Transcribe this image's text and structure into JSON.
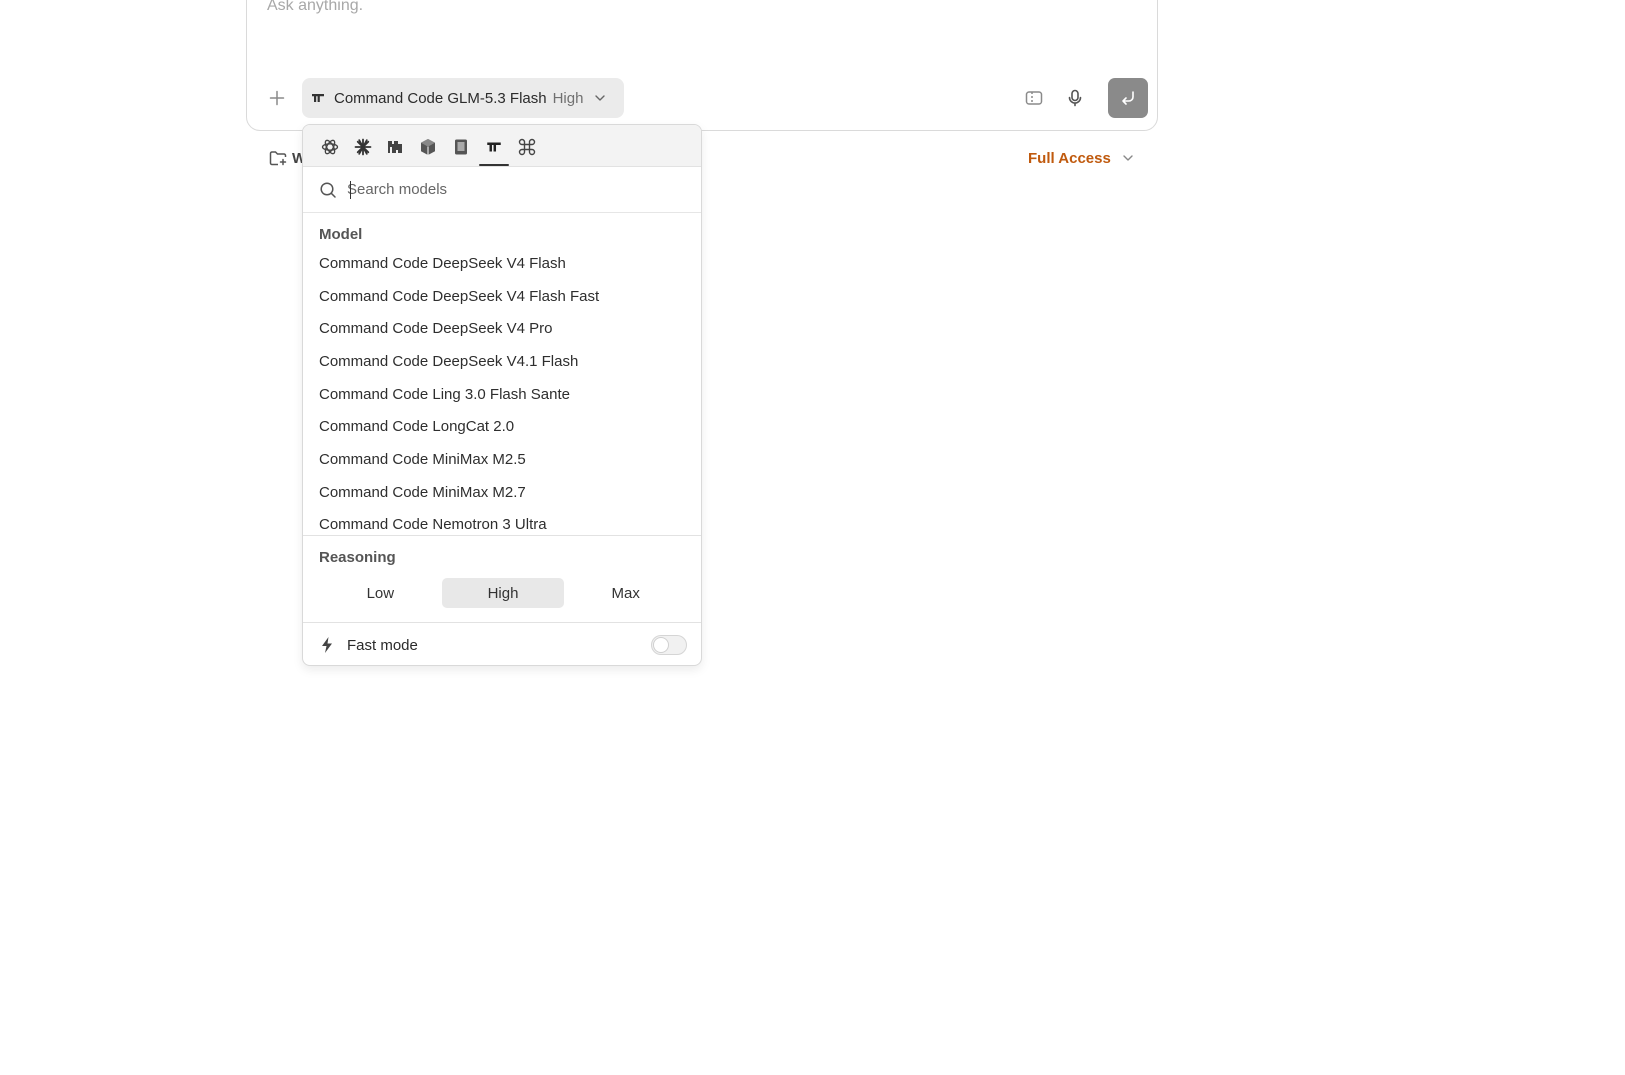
{
  "composer": {
    "prompt_placeholder": "Ask anything.",
    "model_selector": {
      "model": "Command Code GLM-5.3 Flash",
      "reasoning": "High"
    }
  },
  "footer": {
    "workspace_label": "W",
    "access_label": "Full Access",
    "access_color": "#c05a0e"
  },
  "dropdown": {
    "provider_tabs": [
      {
        "icon": "openai-icon"
      },
      {
        "icon": "anthropic-icon"
      },
      {
        "icon": "mistral-icon"
      },
      {
        "icon": "cube-icon"
      },
      {
        "icon": "book-icon"
      },
      {
        "icon": "command-code-icon",
        "active": true
      },
      {
        "icon": "command-key-icon"
      }
    ],
    "search_placeholder": "Search models",
    "model_section_label": "Model",
    "models": [
      "Command Code DeepSeek V4 Flash",
      "Command Code DeepSeek V4 Flash Fast",
      "Command Code DeepSeek V4 Pro",
      "Command Code DeepSeek V4.1 Flash",
      "Command Code Ling 3.0 Flash Sante",
      "Command Code LongCat 2.0",
      "Command Code MiniMax M2.5",
      "Command Code MiniMax M2.7",
      "Command Code Nemotron 3 Ultra"
    ],
    "reasoning_label": "Reasoning",
    "reasoning_options": [
      "Low",
      "High",
      "Max"
    ],
    "reasoning_selected": "High",
    "fast_mode_label": "Fast mode",
    "fast_mode_enabled": false
  }
}
